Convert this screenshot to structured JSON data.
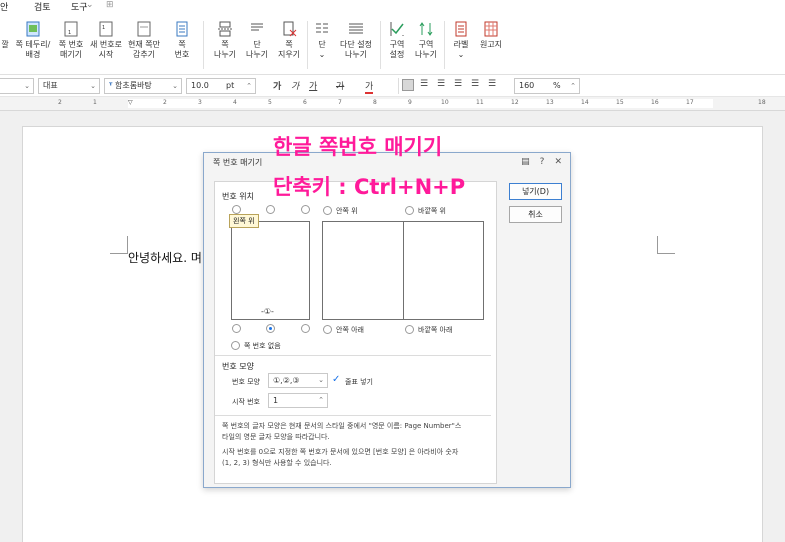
{
  "menu": {
    "m1": "안",
    "m2": "검토",
    "m3": "도구"
  },
  "ribbon": [
    {
      "id": "rb0",
      "l1": "깔",
      "l2": ""
    },
    {
      "id": "rb1",
      "l1": "쪽 테두리/",
      "l2": "배경"
    },
    {
      "id": "rb2",
      "l1": "쪽 번호",
      "l2": "매기기"
    },
    {
      "id": "rb3",
      "l1": "새 번호로",
      "l2": "시작"
    },
    {
      "id": "rb4",
      "l1": "현재 쪽만",
      "l2": "감추기"
    },
    {
      "id": "rb5",
      "l1": "쪽",
      "l2": "번호"
    },
    {
      "id": "rb6",
      "l1": "쪽",
      "l2": "나누기"
    },
    {
      "id": "rb7",
      "l1": "단",
      "l2": "나누기"
    },
    {
      "id": "rb8",
      "l1": "쪽",
      "l2": "지우기"
    },
    {
      "id": "rb9",
      "l1": "단",
      "l2": ""
    },
    {
      "id": "rb10",
      "l1": "다단 설정",
      "l2": "나누기"
    },
    {
      "id": "rb11",
      "l1": "구역",
      "l2": "설정"
    },
    {
      "id": "rb12",
      "l1": "구역",
      "l2": "나누기"
    },
    {
      "id": "rb13",
      "l1": "라벨",
      "l2": ""
    },
    {
      "id": "rb14",
      "l1": "원고지",
      "l2": ""
    }
  ],
  "format": {
    "style": "대표",
    "font": "함초롬바탕",
    "size": "10.0",
    "unit": "pt",
    "zoom": "160",
    "zoom_unit": "%",
    "bold": "가",
    "italic": "가",
    "underline": "가",
    "strike": "가",
    "color": "가"
  },
  "ruler": {
    "ticks": [
      "2",
      "1",
      "2",
      "3",
      "4",
      "5",
      "6",
      "7",
      "8",
      "9",
      "10",
      "11",
      "12",
      "13",
      "14",
      "15",
      "16",
      "17",
      "18"
    ]
  },
  "document": {
    "text": "안녕하세요. 며"
  },
  "overlay": {
    "line1": "한글 쪽번호 매기기",
    "line2": "단축키 : Ctrl+N+P"
  },
  "dialog": {
    "title": "쪽 번호 매기기",
    "ok": "넣기(D)",
    "cancel": "취소",
    "position_section": "번호 위치",
    "tooltip": "왼쪽 위",
    "left_top": "안쪽 위",
    "right_top": "바깥쪽 위",
    "left_bottom": "안쪽 아래",
    "right_bottom": "바깥쪽 아래",
    "no_number": "쪽 번호 없음",
    "sample_number": "-①-",
    "shape_section": "번호 모양",
    "shape_label": "번호 모양",
    "shape_value": "①,②,③",
    "dash_label": "줄표 넣기",
    "start_label": "시작 번호",
    "start_value": "1",
    "note1a": "쪽 번호의 글자 모양은 현재 문서의 스타일 중에서 \"영문 이름: Page Number\"스",
    "note1b": "타일의 영문 글자 모양을 따라갑니다.",
    "note2a": "시작 번호를 0으로 지정한 쪽 번호가 문서에 있으면 [번호 모양] 은 아라비아 숫자",
    "note2b": "(1, 2, 3) 형식만 사용할 수 있습니다."
  },
  "colors": {
    "accent": "#ff1a9a",
    "selection": "#1a73e8"
  }
}
